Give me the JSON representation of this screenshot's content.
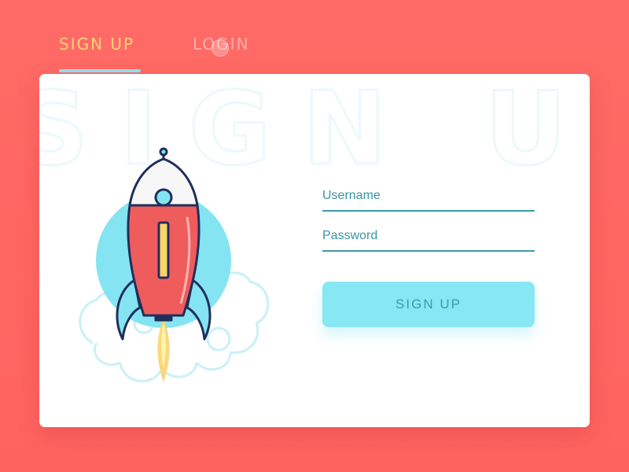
{
  "tabs": {
    "signup_label": "SIGN UP",
    "login_label": "LOGIN"
  },
  "card": {
    "background_word": "SIGN UP"
  },
  "form": {
    "username_placeholder": "Username",
    "password_placeholder": "Password",
    "submit_label": "SIGN UP"
  },
  "illustration": {
    "icon": "rocket-icon",
    "clouds": "cloud-icon"
  },
  "colors": {
    "background": "#ff6464",
    "active_tab": "#ffd47a",
    "accent": "#87e7f3",
    "field_line": "#3f9aa8",
    "rocket_red": "#ef5c5c",
    "outline": "#1f2f5c"
  }
}
